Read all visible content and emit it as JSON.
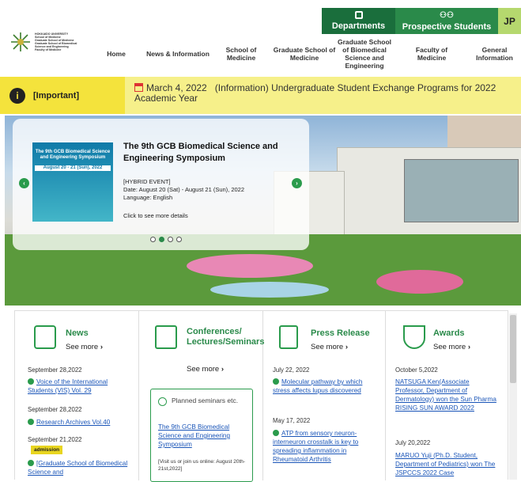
{
  "header": {
    "departments_label": "Departments",
    "prospective_label": "Prospective Students",
    "lang_label": "JP",
    "logo_lines": [
      "HOKKAIDO UNIVERSITY",
      "School of Medicine",
      "Graduate School of Medicine",
      "Graduate School of Biomedical",
      "Science and Engineering",
      "Faculty of Medicine"
    ]
  },
  "nav": [
    {
      "label": "Home"
    },
    {
      "label": "News & Information"
    },
    {
      "label": "School of Medicine"
    },
    {
      "label": "Graduate School of Medicine"
    },
    {
      "label": "Graduate School of Biomedical Science and Engineering"
    },
    {
      "label": "Faculty of Medicine"
    },
    {
      "label": "General Information"
    }
  ],
  "important": {
    "label": "[Important]",
    "date": "March 4, 2022",
    "text": "(Information) Undergraduate Student Exchange Programs for 2022 Academic Year"
  },
  "hero": {
    "poster_title": "The 9th GCB Biomedical Science and Engineering Symposium",
    "poster_dates": "August 20 - 21 (Sun), 2022",
    "title": "The 9th GCB Biomedical Science and Engineering Symposium",
    "event_type": "[HYBRID EVENT]",
    "date_line": "Date: August 20 (Sat) - August 21 (Sun), 2022",
    "language_line": "Language: English",
    "more": "Click to see more details",
    "slides": 4,
    "active_slide": 2
  },
  "columns": {
    "see_more": "See more",
    "news": {
      "title": "News",
      "items": [
        {
          "date": "September 28,2022",
          "text": "Voice of the International Students (VIS) Vol. 29"
        },
        {
          "date": "September 28,2022",
          "text": "Research Archives Vol.40"
        },
        {
          "date": "September 21,2022",
          "badge": "admission",
          "text": "[Graduate School of Biomedical Science and"
        }
      ]
    },
    "conferences": {
      "title": "Conferences/ Lectures/Seminars",
      "box_label": "Planned seminars etc.",
      "event_link": "The 9th GCB Biomedical Science and Engineering Symposium",
      "event_note": "[Visit us or join us online: August 20th-21st,2022]"
    },
    "press": {
      "title": "Press Release",
      "items": [
        {
          "date": "July 22, 2022",
          "text": "Molecular pathway by which stress affects lupus discovered"
        },
        {
          "date": "May 17, 2022",
          "text": "ATP from sensory neuron-interneuron crosstalk is key to spreading inflammation in Rheumatoid Arthritis"
        }
      ]
    },
    "awards": {
      "title": "Awards",
      "items": [
        {
          "date": "October 5,2022",
          "text": "NATSUGA Ken(Associate Professor, Department of Dermatology) won the Sun Pharma RISING SUN AWARD 2022"
        },
        {
          "date": "July 20,2022",
          "text": "MARUO Yuji (Ph.D. Student, Department of Pediatrics) won The JSPCCS 2022 Case"
        }
      ]
    }
  }
}
